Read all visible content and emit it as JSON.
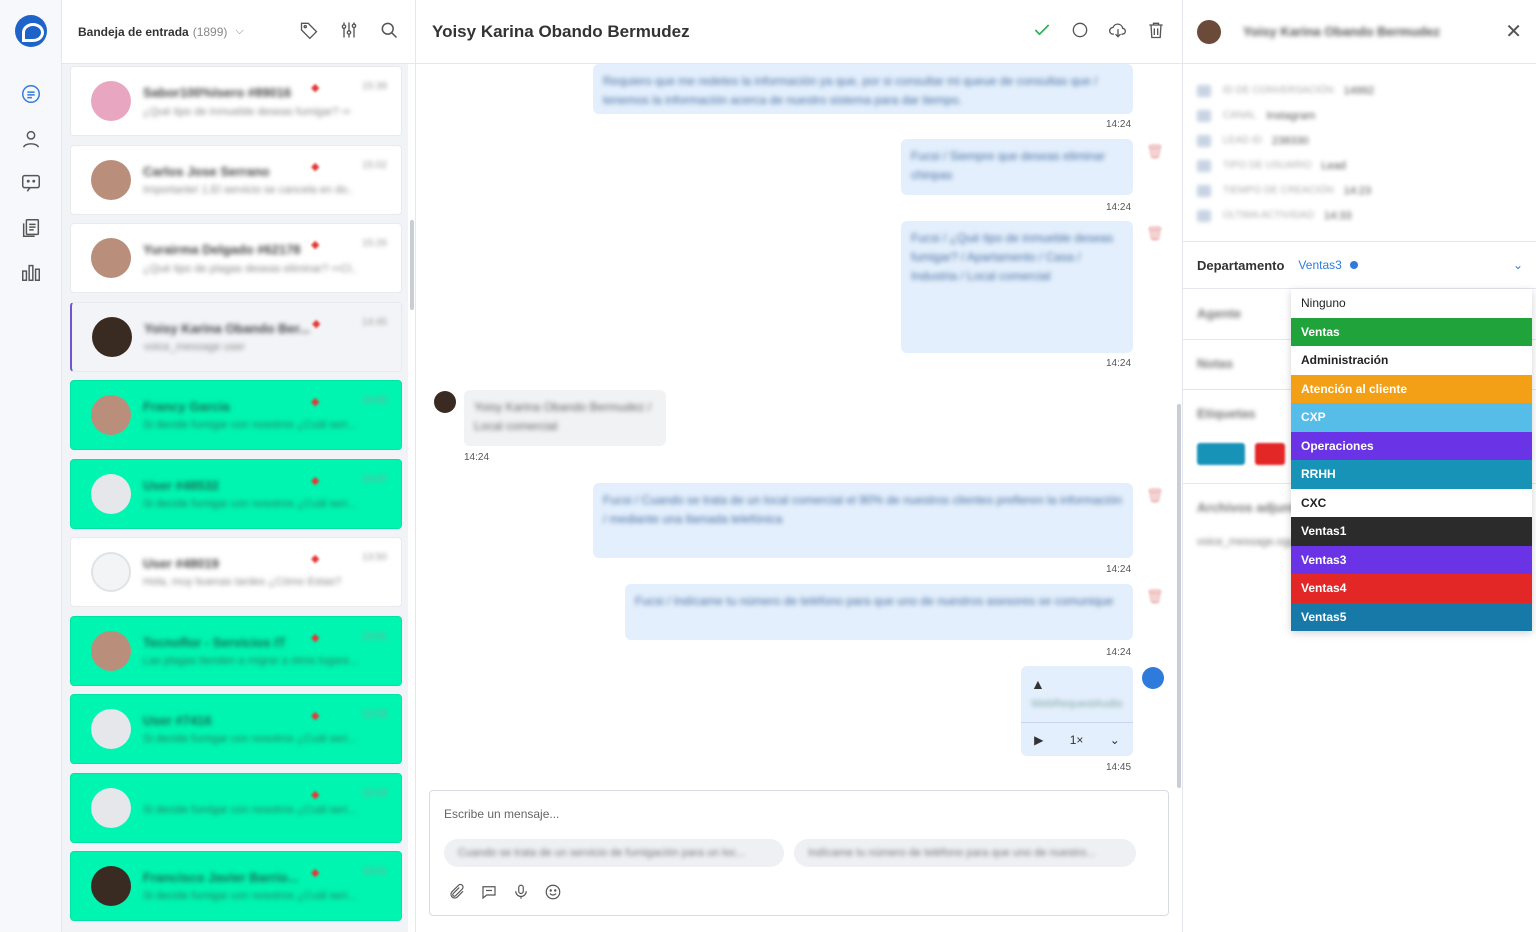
{
  "rail": {
    "items": [
      "chat",
      "contacts",
      "conversations",
      "documents",
      "reports"
    ]
  },
  "list": {
    "inbox_label": "Bandeja de entrada",
    "inbox_count": "(1899)",
    "conversations": [
      {
        "name": "Sabor100%Isero #89016",
        "preview": "¿Qué tipo de inmueble deseas fumigar? ⇨",
        "time": "15:39",
        "style": "white",
        "avatar": "pink"
      },
      {
        "name": "Carlos Jose Serrano",
        "preview": "Importante! 1.El servicio se cancela en do..",
        "time": "15:02",
        "style": "white",
        "avatar": "tan"
      },
      {
        "name": "Yurairma Delgado #62178",
        "preview": "¿Qué tipo de plagas deseas eliminar? ⇨Cl..",
        "time": "15:26",
        "style": "white",
        "avatar": "tan"
      },
      {
        "name": "Yoisy Karina Obando Ber...",
        "preview": "voice_message user",
        "time": "14:45",
        "style": "active",
        "avatar": "dark"
      },
      {
        "name": "Francy Garcia",
        "preview": "Si decide fumigar con nosotros ¿Cuál seri...",
        "time": "14:40",
        "style": "green",
        "avatar": "tan"
      },
      {
        "name": "User #48532",
        "preview": "Si decide fumigar con nosotros ¿Cuál seri...",
        "time": "14:37",
        "style": "green",
        "avatar": "grey"
      },
      {
        "name": "User #48019",
        "preview": "Hola, muy buenas tardes ¿Cómo Estas?",
        "time": "13:50",
        "style": "white",
        "avatar": "white"
      },
      {
        "name": "Tecnoflor - Servicios IT",
        "preview": "Las plagas tienden a migrar a otros lugare...",
        "time": "13:41",
        "style": "green",
        "avatar": "tan"
      },
      {
        "name": "User #7416",
        "preview": "Si decide fumigar con nosotros ¿Cuál seri...",
        "time": "13:33",
        "style": "green",
        "avatar": "grey"
      },
      {
        "name": "",
        "preview": "Si decide fumigar con nosotros ¿Cuál seri...",
        "time": "13:19",
        "style": "green",
        "avatar": "grey"
      },
      {
        "name": "Francisco Javier Barrio...",
        "preview": "Si decide fumigar con nosotros ¿Cuál seri...",
        "time": "13:11",
        "style": "green",
        "avatar": "dark"
      }
    ]
  },
  "chat": {
    "title": "Yoisy Karina Obando Bermudez",
    "messages": [
      {
        "text": "Requiero que me redetes la información ya que, por si consultar mi queue de consultas que / tenemos la información acerca de nuestro sistema para dar tiempo.",
        "time": "14:24"
      },
      {
        "text": "Fucsi / Siempre que deseas eliminar chinpas",
        "time": "14:24"
      },
      {
        "text": "Fucsi / ¿Qué tipo de inmueble deseas fumigar? / Apartamento / Casa / Industria / Local comercial",
        "time": "14:24"
      },
      {
        "text": "Yoisy Karina Obando Bermudez / Local comercial",
        "time": "14:24"
      },
      {
        "text": "Fucsi / Cuando se trata de un local comercial el 90% de nuestros clientes prefieren la información / mediante una llamada telefónica",
        "time": "14:24"
      },
      {
        "text": "Fucsi / Indícame tu número de teléfono para que uno de nuestros asesores se comunique",
        "time": "14:24"
      },
      {
        "text": "WebRequestAudio",
        "time": "14:45"
      }
    ],
    "audio_speed": "1×",
    "composer_placeholder": "Escribe un mensaje...",
    "quick_replies": [
      "Cuando se trata de un servicio de fumigación para un loc...",
      "Indícame tu número de teléfono para que uno de nuestro..."
    ]
  },
  "panel": {
    "contact_name": "Yoisy Karina Obando Bermudez",
    "info": [
      {
        "key": "ID DE CONVERSACIÓN",
        "value": "14992"
      },
      {
        "key": "CANAL",
        "value": "Instagram"
      },
      {
        "key": "LEAD ID",
        "value": "238330"
      },
      {
        "key": "TIPO DE USUARIO",
        "value": "Lead"
      },
      {
        "key": "TIEMPO DE CREACIÓN",
        "value": "14:23"
      },
      {
        "key": "ÚLTIMA ACTIVIDAD",
        "value": "14:33"
      }
    ],
    "department_label": "Departamento",
    "department_value": "Ventas3",
    "agent_label": "Agente",
    "notes_label": "Notas",
    "labels_label": "Etiquetas",
    "attachments_label": "Archivos adjuntos",
    "attachment_item": "voice_message.ogg"
  },
  "dropdown": {
    "options": [
      {
        "label": "Ninguno",
        "bg": "#ffffff",
        "fg": "#222222"
      },
      {
        "label": "Ventas",
        "bg": "#1fa33a",
        "fg": "#ffffff"
      },
      {
        "label": "Administración",
        "bg": "#ffffff",
        "fg": "#222222"
      },
      {
        "label": "Atención al cliente",
        "bg": "#f4a017",
        "fg": "#ffffff"
      },
      {
        "label": "CXP",
        "bg": "#55bde8",
        "fg": "#ffffff"
      },
      {
        "label": "Operaciones",
        "bg": "#6b33e6",
        "fg": "#ffffff"
      },
      {
        "label": "RRHH",
        "bg": "#1893b8",
        "fg": "#ffffff"
      },
      {
        "label": "CXC",
        "bg": "#ffffff",
        "fg": "#222222"
      },
      {
        "label": "Ventas1",
        "bg": "#2b2b2b",
        "fg": "#ffffff"
      },
      {
        "label": "Ventas3",
        "bg": "#6b33e6",
        "fg": "#ffffff"
      },
      {
        "label": "Ventas4",
        "bg": "#e32626",
        "fg": "#ffffff"
      },
      {
        "label": "Ventas5",
        "bg": "#1679a8",
        "fg": "#ffffff"
      }
    ]
  }
}
